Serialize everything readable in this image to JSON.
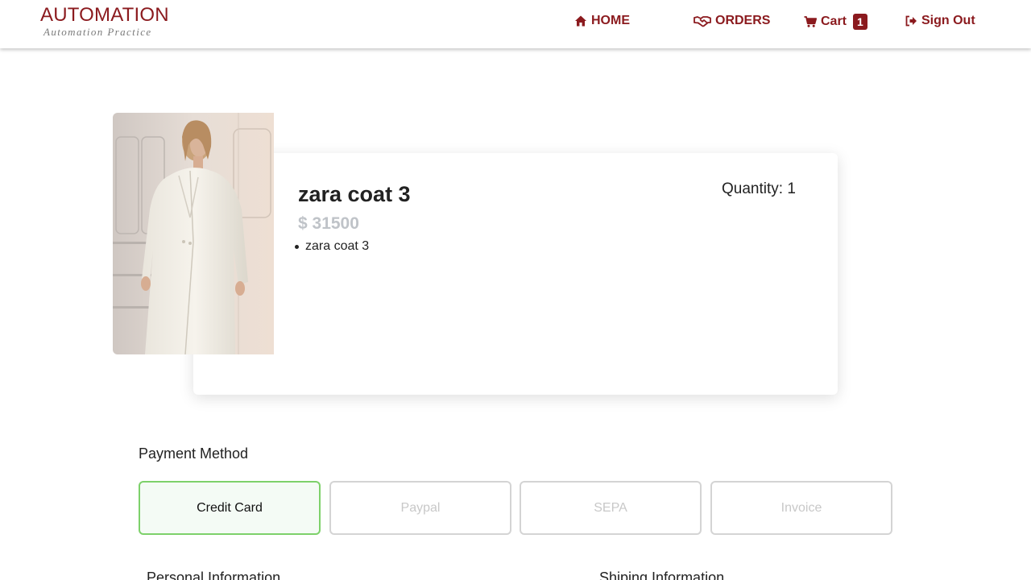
{
  "header": {
    "brand_title": "AUTOMATION",
    "brand_subtitle": "Automation Practice",
    "nav": {
      "home": "HOME",
      "orders": "ORDERS",
      "cart": "Cart",
      "cart_count": "1",
      "signout": "Sign Out"
    },
    "icons": [
      "home-icon",
      "handshake-icon",
      "cart-icon",
      "sign-out-icon"
    ],
    "accent_color": "#8b1a1e"
  },
  "product": {
    "name": "zara coat 3",
    "price": "$ 31500",
    "description_items": [
      "zara coat 3"
    ],
    "quantity": "Quantity: 1"
  },
  "payment": {
    "title": "Payment Method",
    "options": [
      "Credit Card",
      "Paypal",
      "SEPA",
      "Invoice"
    ],
    "selected": "Credit Card",
    "selected_border_color": "#7dd16a"
  },
  "sections": {
    "personal": "Personal Information",
    "shipping": "Shiping Information"
  }
}
